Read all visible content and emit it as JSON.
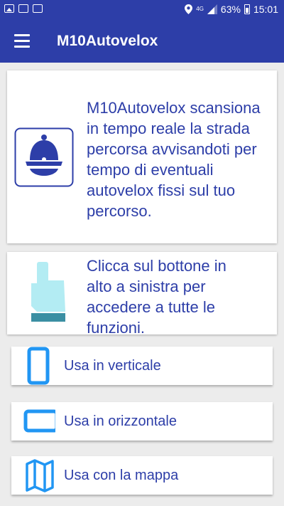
{
  "status_bar": {
    "network_label": "4G",
    "battery_percent": "63%",
    "time": "15:01"
  },
  "toolbar": {
    "title": "M10Autovelox"
  },
  "info_card": {
    "text": "M10Autovelox scansiona in tempo reale la strada percorsa avvisandoti per tempo di eventuali autovelox fissi sul tuo percorso."
  },
  "hint_card": {
    "text": "Clicca sul bottone in alto a sinistra per accedere a tutte le funzioni."
  },
  "buttons": [
    {
      "label": "Usa in verticale",
      "icon": "phone-portrait-icon"
    },
    {
      "label": "Usa in orizzontale",
      "icon": "phone-landscape-icon"
    },
    {
      "label": "Usa con la mappa",
      "icon": "map-icon"
    }
  ],
  "colors": {
    "primary": "#2d3ea8",
    "accent": "#2196f3",
    "background": "#ececec"
  }
}
